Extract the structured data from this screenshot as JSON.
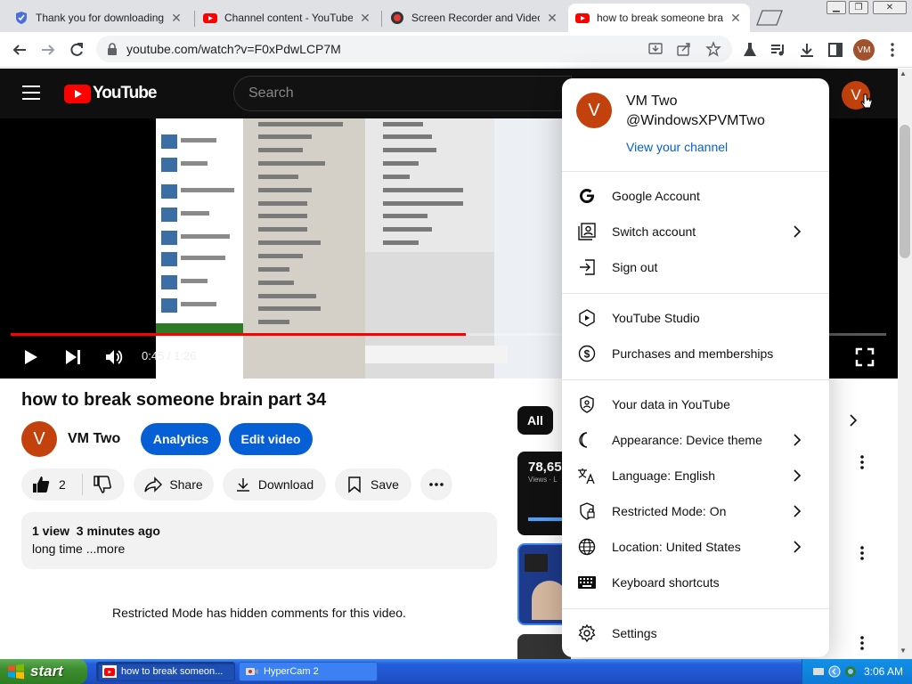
{
  "browser": {
    "tabs": [
      {
        "title": "Thank you for downloading N",
        "icon": "shield-favicon-icon",
        "active": false
      },
      {
        "title": "Channel content - YouTube S",
        "icon": "youtube-favicon-icon",
        "active": false
      },
      {
        "title": "Screen Recorder and Video C",
        "icon": "recorder-favicon-icon",
        "active": false
      },
      {
        "title": "how to break someone brain",
        "icon": "youtube-favicon-icon",
        "active": true
      }
    ],
    "url": "youtube.com/watch?v=F0xPdwLCP7M",
    "profile_initials": "VM"
  },
  "youtube": {
    "logo_text": "YouTube",
    "search_placeholder": "Search",
    "avatar_letter": "V",
    "video": {
      "time": "0:45 / 1:26",
      "progress": 0.52,
      "title": "how to break someone brain part 34"
    },
    "channel": {
      "name": "VM Two",
      "avatar_letter": "V"
    },
    "buttons": {
      "analytics": "Analytics",
      "edit_video": "Edit video",
      "like_count": "2",
      "share": "Share",
      "download": "Download",
      "save": "Save"
    },
    "description": {
      "stats": "1 view  3 minutes ago",
      "text": "long time ...more"
    },
    "comments_notice": "Restricted Mode has hidden comments for this video.",
    "sidebar": {
      "chip_all": "All",
      "card_views": "78,65",
      "card_sub": "Views · L"
    }
  },
  "account_menu": {
    "name": "VM Two",
    "handle": "@WindowsXPVMTwo",
    "view_channel": "View your channel",
    "avatar_letter": "V",
    "groups": [
      [
        {
          "label": "Google Account",
          "icon": "google-icon",
          "chevron": false
        },
        {
          "label": "Switch account",
          "icon": "switch-account-icon",
          "chevron": true
        },
        {
          "label": "Sign out",
          "icon": "sign-out-icon",
          "chevron": false
        }
      ],
      [
        {
          "label": "YouTube Studio",
          "icon": "studio-icon",
          "chevron": false
        },
        {
          "label": "Purchases and memberships",
          "icon": "dollar-icon",
          "chevron": false
        }
      ],
      [
        {
          "label": "Your data in YouTube",
          "icon": "shield-person-icon",
          "chevron": false
        },
        {
          "label": "Appearance: Device theme",
          "icon": "moon-icon",
          "chevron": true
        },
        {
          "label": "Language: English",
          "icon": "translate-icon",
          "chevron": true
        },
        {
          "label": "Restricted Mode: On",
          "icon": "restricted-icon",
          "chevron": true
        },
        {
          "label": "Location: United States",
          "icon": "globe-icon",
          "chevron": true
        },
        {
          "label": "Keyboard shortcuts",
          "icon": "keyboard-icon",
          "chevron": false
        }
      ],
      [
        {
          "label": "Settings",
          "icon": "gear-icon",
          "chevron": false
        }
      ]
    ]
  },
  "taskbar": {
    "start_label": "start",
    "items": [
      {
        "label": "how to break someon...",
        "active": true
      },
      {
        "label": "HyperCam 2",
        "active": false
      }
    ],
    "clock": "3:06 AM"
  },
  "colors": {
    "youtube_red": "#ff0000",
    "avatar_bg": "#c2410c",
    "link_blue": "#065fd4",
    "xp_blue": "#245edc",
    "xp_green": "#3c8d2f"
  }
}
